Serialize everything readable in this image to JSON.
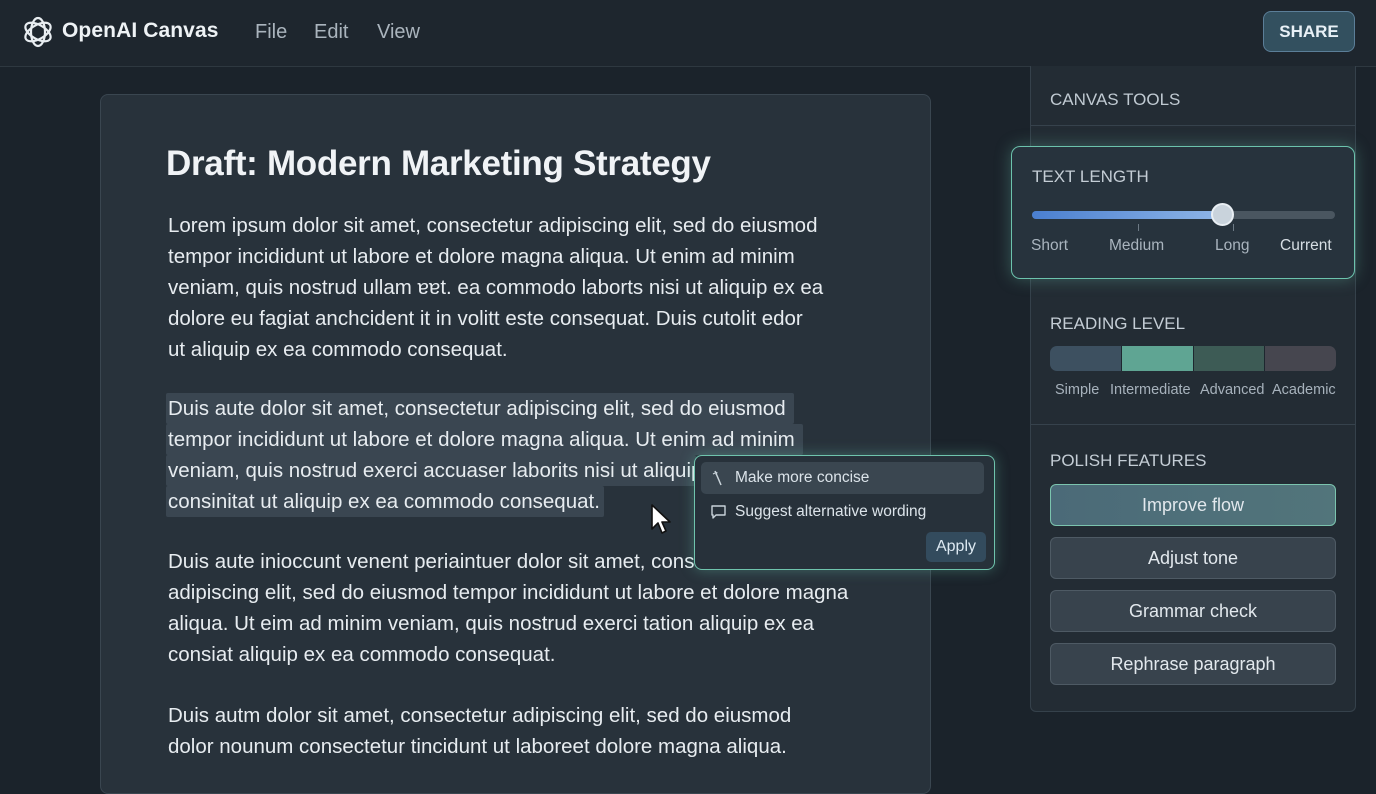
{
  "app": {
    "title": "OpenAI Canvas",
    "menu": [
      "File",
      "Edit",
      "View"
    ],
    "share_label": "SHARE"
  },
  "document": {
    "title": "Draft: Modern Marketing Strategy",
    "paragraphs": [
      {
        "highlighted": false,
        "lines": [
          "Lorem ipsum dolor sit amet, consectetur adipiscing elit, sed do eiusmod",
          "tempor incididunt ut labore et dolore magna aliqua. Ut enim ad minim",
          "veniam, quis nostrud ullam ɐɐt. ea commodo laborts nisi ut aliquip ex ea",
          "dolore eu fagiat anchcident it in volitt este consequat. Duis cutolit edor",
          "ut aliquip ex ea commodo consequat."
        ]
      },
      {
        "highlighted": true,
        "lines": [
          "Duis aute dolor sit amet, consectetur adipiscing elit, sed do eiusmod",
          "tempor incididunt ut labore et dolore magna aliqua. Ut enim ad minim",
          "veniam, quis nostrud exerci accuaser laborits nisi ut aliquip",
          "consinitat ut aliquip ex ea commodo consequat."
        ]
      },
      {
        "highlighted": false,
        "lines": [
          "Duis aute inioccunt  venent periaintuer dolor sit amet, conse",
          "adipiscing elit, sed do eiusmod tempor incididunt ut labore et dolore magna",
          "aliqua. Ut eim ad minim veniam, quis nostrud exerci tation aliquip ex ea",
          "consiat aliquip ex ea commodo consequat."
        ]
      },
      {
        "highlighted": false,
        "lines": [
          "Duis autm dolor sit amet, consectetur adipiscing elit, sed do eiusmod",
          "dolor nounum consectetur tincidunt ut laboreet dolore magna aliqua."
        ]
      }
    ]
  },
  "popup": {
    "items": [
      {
        "label": "Make more concise",
        "icon": "wand-icon",
        "active": true
      },
      {
        "label": "Suggest alternative wording",
        "icon": "comment-icon",
        "active": false
      }
    ],
    "apply_label": "Apply"
  },
  "panel": {
    "heading": "CANVAS TOOLS",
    "text_length": {
      "label": "TEXT LENGTH",
      "stops": [
        "Short",
        "Medium",
        "Long",
        "Current"
      ],
      "value_fraction": 0.63
    },
    "reading_level": {
      "label": "READING LEVEL",
      "levels": [
        "Simple",
        "Intermediate",
        "Advanced",
        "Academic"
      ],
      "selected": "Intermediate",
      "colors": [
        "#3d5060",
        "#5fa593",
        "#3d5b55",
        "#46464f"
      ]
    },
    "polish": {
      "label": "POLISH FEATURES",
      "buttons": [
        {
          "label": "Improve flow",
          "active": true
        },
        {
          "label": "Adjust tone",
          "active": false
        },
        {
          "label": "Grammar check",
          "active": false
        },
        {
          "label": "Rephrase paragraph",
          "active": false
        }
      ]
    }
  },
  "colors": {
    "accent": "#6fc4ad",
    "slider_fill": "#5b8fdb",
    "background": "#1b232b"
  }
}
